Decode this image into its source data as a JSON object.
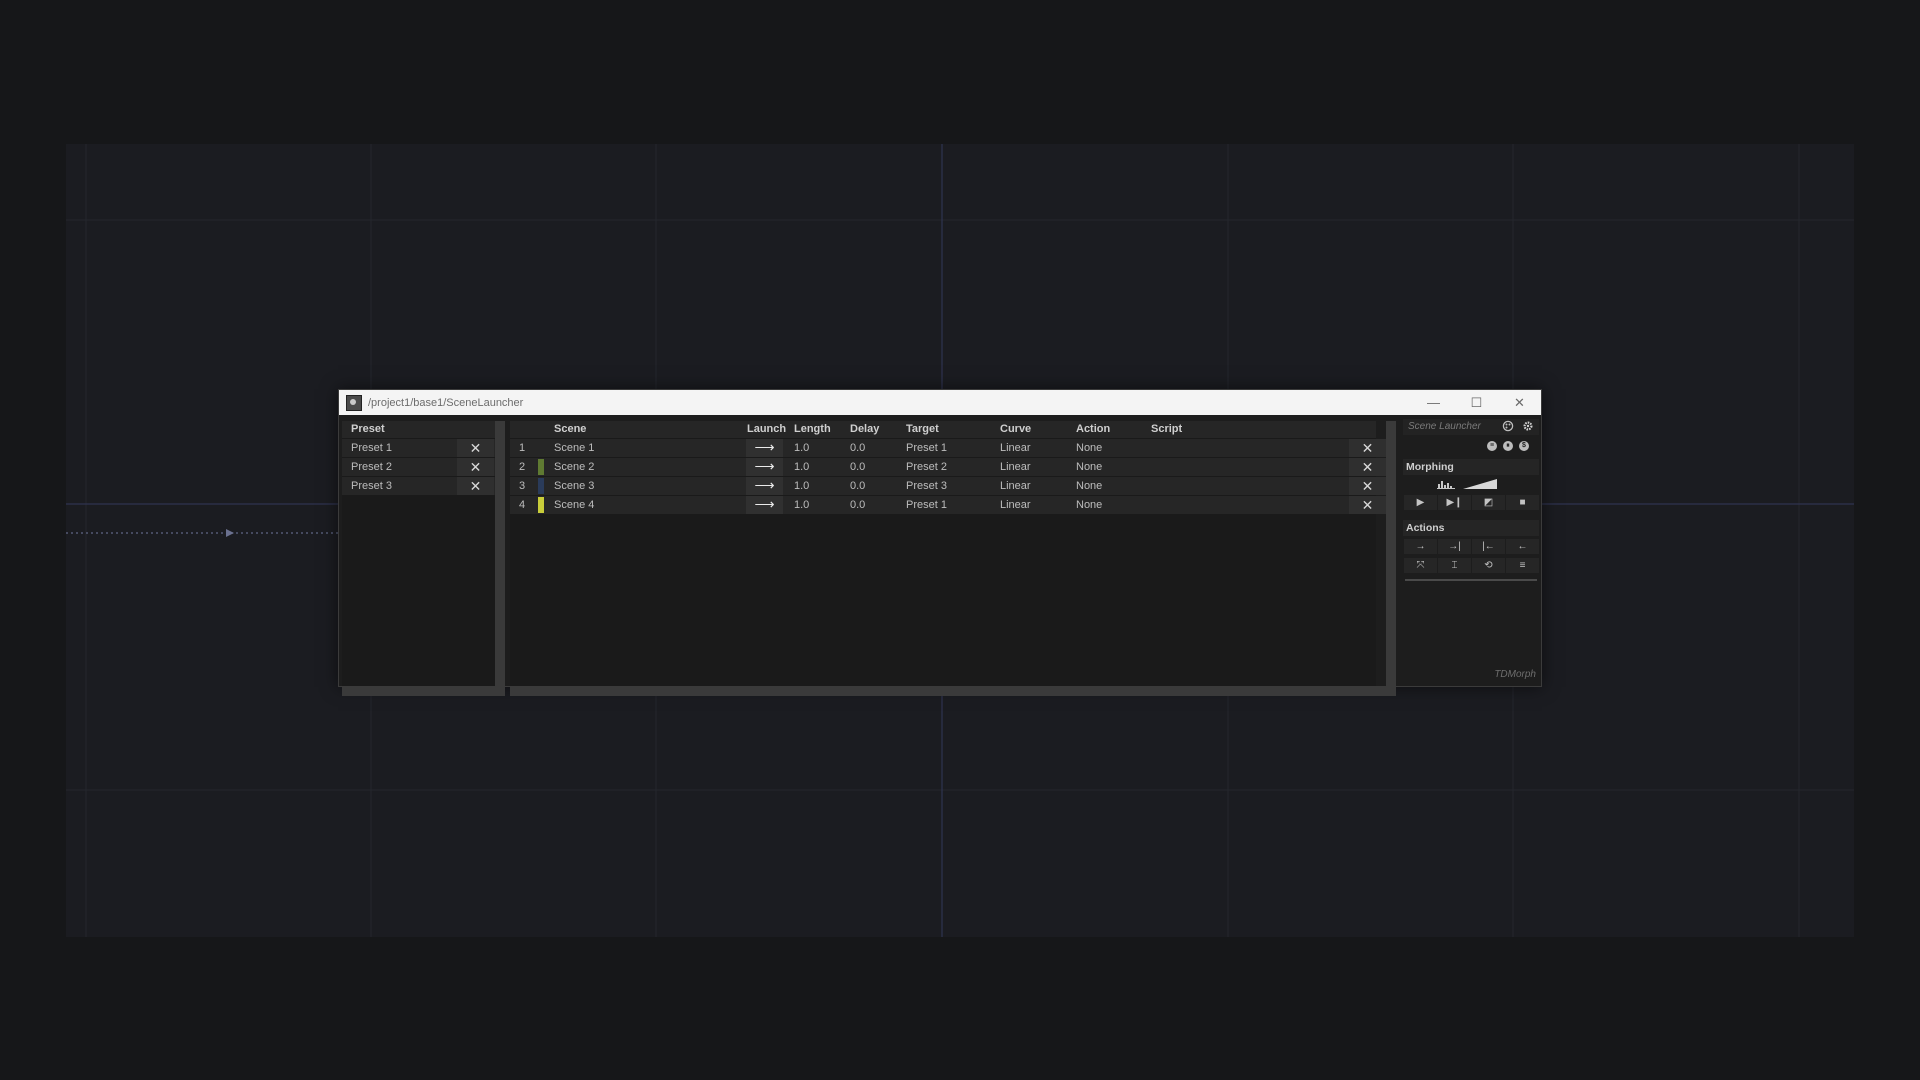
{
  "window": {
    "title": "/project1/base1/SceneLauncher",
    "controls": {
      "minimize": "—",
      "maximize": "☐",
      "close": "✕"
    }
  },
  "presets": {
    "header": "Preset",
    "rows": [
      {
        "name": "Preset 1",
        "remove": "✕"
      },
      {
        "name": "Preset 2",
        "remove": "✕"
      },
      {
        "name": "Preset 3",
        "remove": "✕"
      }
    ]
  },
  "scenes": {
    "columns": {
      "scene": "Scene",
      "launch": "Launch",
      "length": "Length",
      "delay": "Delay",
      "target": "Target",
      "curve": "Curve",
      "action": "Action",
      "script": "Script"
    },
    "launch_glyph": "⟶",
    "remove_glyph": "✕",
    "rows": [
      {
        "index": "1",
        "color": "",
        "name": "Scene 1",
        "length": "1.0",
        "delay": "0.0",
        "target": "Preset 1",
        "curve": "Linear",
        "action": "None",
        "script": ""
      },
      {
        "index": "2",
        "color": "#5f7a32",
        "name": "Scene 2",
        "length": "1.0",
        "delay": "0.0",
        "target": "Preset 2",
        "curve": "Linear",
        "action": "None",
        "script": ""
      },
      {
        "index": "3",
        "color": "#2a3b5a",
        "name": "Scene 3",
        "length": "1.0",
        "delay": "0.0",
        "target": "Preset 3",
        "curve": "Linear",
        "action": "None",
        "script": ""
      },
      {
        "index": "4",
        "color": "#c8cd3a",
        "name": "Scene 4",
        "length": "1.0",
        "delay": "0.0",
        "target": "Preset 1",
        "curve": "Linear",
        "action": "None",
        "script": ""
      }
    ]
  },
  "side": {
    "title": "Scene Launcher",
    "morphing_label": "Morphing",
    "actions_label": "Actions",
    "brand": "TDMorph",
    "icons": {
      "palette": "palette-icon",
      "settings": "gear-icon",
      "circle_a": "list-circle-icon",
      "circle_b": "pause-circle-icon",
      "circle_c": "dollar-circle-icon"
    },
    "circle_glyphs": [
      "≡",
      "⏸",
      "$"
    ],
    "morph_buttons": [
      "▶",
      "▶❙",
      "◩",
      "■"
    ],
    "action_buttons_row1": [
      "→",
      "→|",
      "|←",
      "←"
    ],
    "action_buttons_row2": [
      "⤧",
      "⌶",
      "⟲",
      "≡"
    ]
  }
}
